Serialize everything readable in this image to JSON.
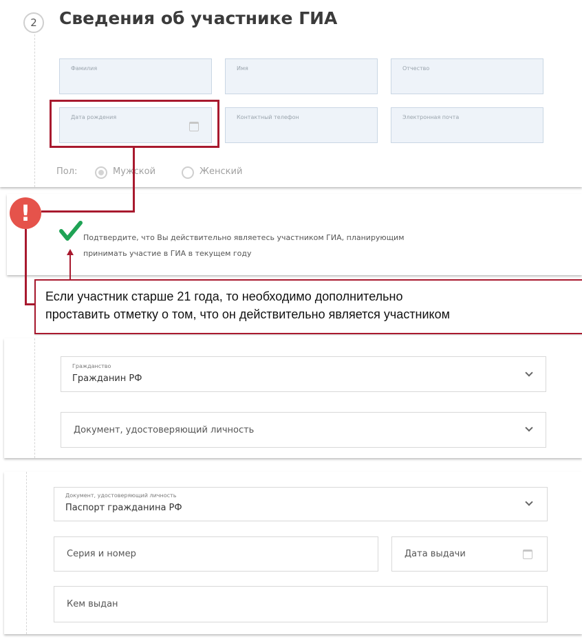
{
  "section": {
    "step_number": "2",
    "title": "Сведения об участнике ГИА"
  },
  "participant_fields": {
    "last_name": "Фамилия",
    "first_name": "Имя",
    "patronymic": "Отчество",
    "birth_date": "Дата рождения",
    "phone": "Контактный телефон",
    "email": "Электронная почта"
  },
  "gender": {
    "label": "Пол:",
    "male": "Мужской",
    "female": "Женский"
  },
  "confirmation": {
    "line1": "Подтвердите, что Вы действительно являетесь участником ГИА, планирующим",
    "line2": "принимать участие в ГИА в текущем году"
  },
  "callout": {
    "line1": "Если участник старше 21 года, то необходимо дополнительно",
    "line2": "проставить отметку о том, что он действительно является участником"
  },
  "citizenship": {
    "label": "Гражданство",
    "value": "Гражданин РФ"
  },
  "identity_doc_placeholder": "Документ, удостоверяющий личность",
  "passport_block": {
    "doc_label": "Документ, удостоверяющий личность",
    "doc_value": "Паспорт гражданина РФ",
    "series_number": "Серия и номер",
    "issue_date": "Дата выдачи",
    "issued_by": "Кем выдан"
  },
  "colors": {
    "annotation_red": "#a8192e",
    "warning_red": "#e5534b",
    "check_green": "#1fa355"
  }
}
